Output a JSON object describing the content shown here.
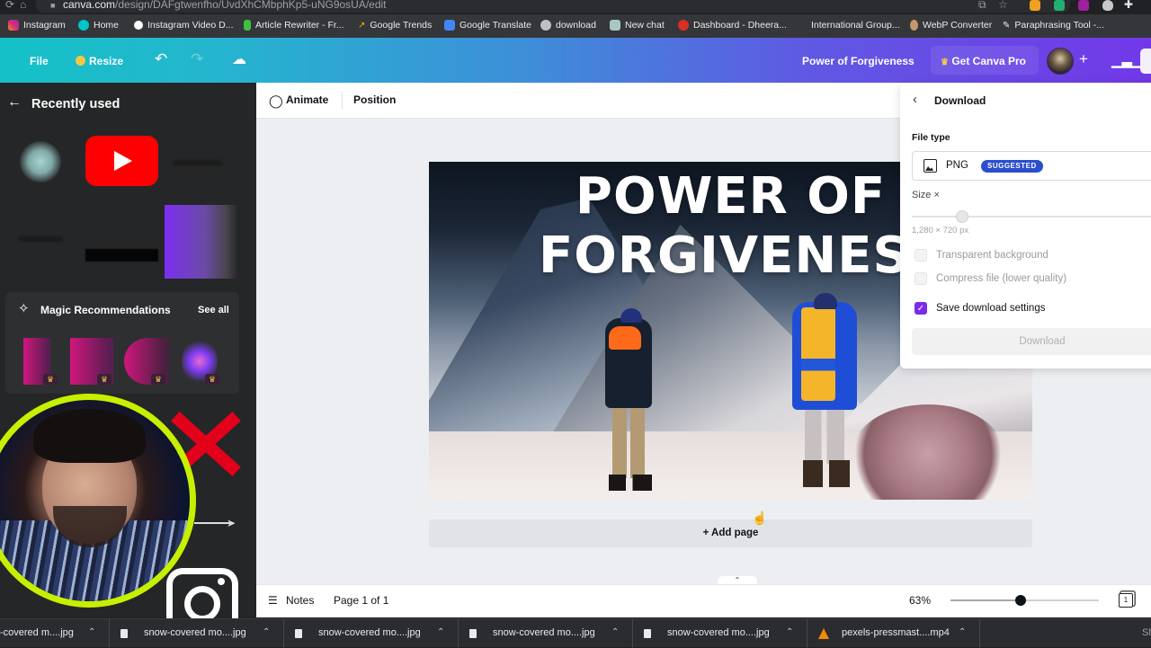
{
  "browser": {
    "url_host": "canva.com",
    "url_path": "/design/DAFgtwenfho/UvdXhCMbphKp5-uNG9osUA/edit",
    "bookmarks": [
      {
        "label": "Instagram",
        "icon": "instagram-icon",
        "color": "#e1306c"
      },
      {
        "label": "Home",
        "icon": "canva-icon",
        "color": "#00c4cc"
      },
      {
        "label": "Instagram Video D...",
        "icon": "download-icon",
        "color": "#ffffff"
      },
      {
        "label": "Article Rewriter - Fr...",
        "icon": "article-icon",
        "color": "#3ec13e"
      },
      {
        "label": "Google Trends",
        "icon": "trends-icon",
        "color": "#f4b400"
      },
      {
        "label": "Google Translate",
        "icon": "translate-icon",
        "color": "#4285f4"
      },
      {
        "label": "download",
        "icon": "globe-icon",
        "color": "#bdc1c6"
      },
      {
        "label": "New chat",
        "icon": "chat-icon",
        "color": "#a9c7c4"
      },
      {
        "label": "Dashboard - Dheera...",
        "icon": "dashboard-icon",
        "color": "#d93025"
      },
      {
        "label": "International Group...",
        "icon": "",
        "color": ""
      },
      {
        "label": "WebP Converter",
        "icon": "user-icon",
        "color": "#c49a6c"
      },
      {
        "label": "Paraphrasing Tool -...",
        "icon": "pen-icon",
        "color": "#e8eaed"
      }
    ]
  },
  "topbar": {
    "file_label": "File",
    "resize_label": "Resize",
    "design_title": "Power of Forgiveness",
    "get_pro_label": "Get Canva Pro",
    "add_label": "+"
  },
  "left_panel": {
    "title": "Recently used",
    "magic": {
      "title": "Magic Recommendations",
      "see_all": "See all"
    }
  },
  "context_bar": {
    "animate_label": "Animate",
    "position_label": "Position"
  },
  "design": {
    "title_line1": "POWER OF",
    "title_line2": "FORGIVENESS"
  },
  "canvas": {
    "add_page_label": "+ Add page"
  },
  "bottom_bar": {
    "notes_label": "Notes",
    "page_indicator": "Page 1 of 1",
    "zoom_label": "63%",
    "zoom_fraction": 0.47,
    "page_count": "1"
  },
  "download_panel": {
    "title": "Download",
    "file_type_label": "File type",
    "file_type_value": "PNG",
    "badge": "SUGGESTED",
    "size_label": "Size ×",
    "size_fraction": 0.2,
    "size_dims": "1,280 × 720 px",
    "options": [
      {
        "label": "Transparent background",
        "checked": false,
        "enabled": false
      },
      {
        "label": "Compress file (lower quality)",
        "checked": false,
        "enabled": false
      },
      {
        "label": "Save download settings",
        "checked": true,
        "enabled": true
      }
    ],
    "download_button": "Download"
  },
  "downloads_shelf": {
    "items": [
      {
        "name": "-covered m....jpg"
      },
      {
        "name": "snow-covered mo....jpg"
      },
      {
        "name": "snow-covered mo....jpg"
      },
      {
        "name": "snow-covered mo....jpg"
      },
      {
        "name": "snow-covered mo....jpg"
      },
      {
        "name": "pexels-pressmast....mp4"
      }
    ],
    "show_all": "Sh"
  }
}
